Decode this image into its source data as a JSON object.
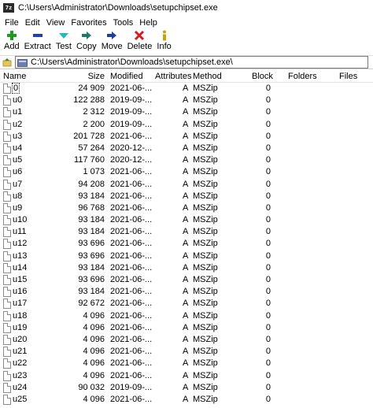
{
  "window": {
    "title": "C:\\Users\\Administrator\\Downloads\\setupchipset.exe",
    "app_icon_text": "7z"
  },
  "menu": [
    "File",
    "Edit",
    "View",
    "Favorites",
    "Tools",
    "Help"
  ],
  "toolbar": [
    {
      "label": "Add",
      "icon": "plus-icon",
      "color": "#1a9e1a"
    },
    {
      "label": "Extract",
      "icon": "minus-icon",
      "color": "#1f3fbf"
    },
    {
      "label": "Test",
      "icon": "chevron-down-icon",
      "color": "#20b8c0"
    },
    {
      "label": "Copy",
      "icon": "arrow-right-icon",
      "color": "#1d7a6b"
    },
    {
      "label": "Move",
      "icon": "arrow-right-icon",
      "color": "#1f3f9f"
    },
    {
      "label": "Delete",
      "icon": "delete-x-icon",
      "color": "#d31c1c"
    },
    {
      "label": "Info",
      "icon": "info-icon",
      "color": "#c9a300"
    }
  ],
  "address": {
    "path": "C:\\Users\\Administrator\\Downloads\\setupchipset.exe\\"
  },
  "columns": {
    "name": "Name",
    "size": "Size",
    "modified": "Modified",
    "attributes": "Attributes",
    "method": "Method",
    "block": "Block",
    "folders": "Folders",
    "files": "Files"
  },
  "files": [
    {
      "name": "0",
      "size": "24 909",
      "modified": "2021-06-...",
      "attr": "A",
      "method": "MSZip",
      "block": "0"
    },
    {
      "name": "u0",
      "size": "122 288",
      "modified": "2019-09-...",
      "attr": "A",
      "method": "MSZip",
      "block": "0"
    },
    {
      "name": "u1",
      "size": "2 312",
      "modified": "2019-09-...",
      "attr": "A",
      "method": "MSZip",
      "block": "0"
    },
    {
      "name": "u2",
      "size": "2 200",
      "modified": "2019-09-...",
      "attr": "A",
      "method": "MSZip",
      "block": "0"
    },
    {
      "name": "u3",
      "size": "201 728",
      "modified": "2021-06-...",
      "attr": "A",
      "method": "MSZip",
      "block": "0"
    },
    {
      "name": "u4",
      "size": "57 264",
      "modified": "2020-12-...",
      "attr": "A",
      "method": "MSZip",
      "block": "0"
    },
    {
      "name": "u5",
      "size": "117 760",
      "modified": "2020-12-...",
      "attr": "A",
      "method": "MSZip",
      "block": "0"
    },
    {
      "name": "u6",
      "size": "1 073",
      "modified": "2021-06-...",
      "attr": "A",
      "method": "MSZip",
      "block": "0"
    },
    {
      "name": "u7",
      "size": "94 208",
      "modified": "2021-06-...",
      "attr": "A",
      "method": "MSZip",
      "block": "0"
    },
    {
      "name": "u8",
      "size": "93 184",
      "modified": "2021-06-...",
      "attr": "A",
      "method": "MSZip",
      "block": "0"
    },
    {
      "name": "u9",
      "size": "96 768",
      "modified": "2021-06-...",
      "attr": "A",
      "method": "MSZip",
      "block": "0"
    },
    {
      "name": "u10",
      "size": "93 184",
      "modified": "2021-06-...",
      "attr": "A",
      "method": "MSZip",
      "block": "0"
    },
    {
      "name": "u11",
      "size": "93 184",
      "modified": "2021-06-...",
      "attr": "A",
      "method": "MSZip",
      "block": "0"
    },
    {
      "name": "u12",
      "size": "93 696",
      "modified": "2021-06-...",
      "attr": "A",
      "method": "MSZip",
      "block": "0"
    },
    {
      "name": "u13",
      "size": "93 696",
      "modified": "2021-06-...",
      "attr": "A",
      "method": "MSZip",
      "block": "0"
    },
    {
      "name": "u14",
      "size": "93 184",
      "modified": "2021-06-...",
      "attr": "A",
      "method": "MSZip",
      "block": "0"
    },
    {
      "name": "u15",
      "size": "93 696",
      "modified": "2021-06-...",
      "attr": "A",
      "method": "MSZip",
      "block": "0"
    },
    {
      "name": "u16",
      "size": "93 184",
      "modified": "2021-06-...",
      "attr": "A",
      "method": "MSZip",
      "block": "0"
    },
    {
      "name": "u17",
      "size": "92 672",
      "modified": "2021-06-...",
      "attr": "A",
      "method": "MSZip",
      "block": "0"
    },
    {
      "name": "u18",
      "size": "4 096",
      "modified": "2021-06-...",
      "attr": "A",
      "method": "MSZip",
      "block": "0"
    },
    {
      "name": "u19",
      "size": "4 096",
      "modified": "2021-06-...",
      "attr": "A",
      "method": "MSZip",
      "block": "0"
    },
    {
      "name": "u20",
      "size": "4 096",
      "modified": "2021-06-...",
      "attr": "A",
      "method": "MSZip",
      "block": "0"
    },
    {
      "name": "u21",
      "size": "4 096",
      "modified": "2021-06-...",
      "attr": "A",
      "method": "MSZip",
      "block": "0"
    },
    {
      "name": "u22",
      "size": "4 096",
      "modified": "2021-06-...",
      "attr": "A",
      "method": "MSZip",
      "block": "0"
    },
    {
      "name": "u23",
      "size": "4 096",
      "modified": "2021-06-...",
      "attr": "A",
      "method": "MSZip",
      "block": "0"
    },
    {
      "name": "u24",
      "size": "90 032",
      "modified": "2019-09-...",
      "attr": "A",
      "method": "MSZip",
      "block": "0"
    },
    {
      "name": "u25",
      "size": "4 096",
      "modified": "2021-06-...",
      "attr": "A",
      "method": "MSZip",
      "block": "0"
    }
  ]
}
